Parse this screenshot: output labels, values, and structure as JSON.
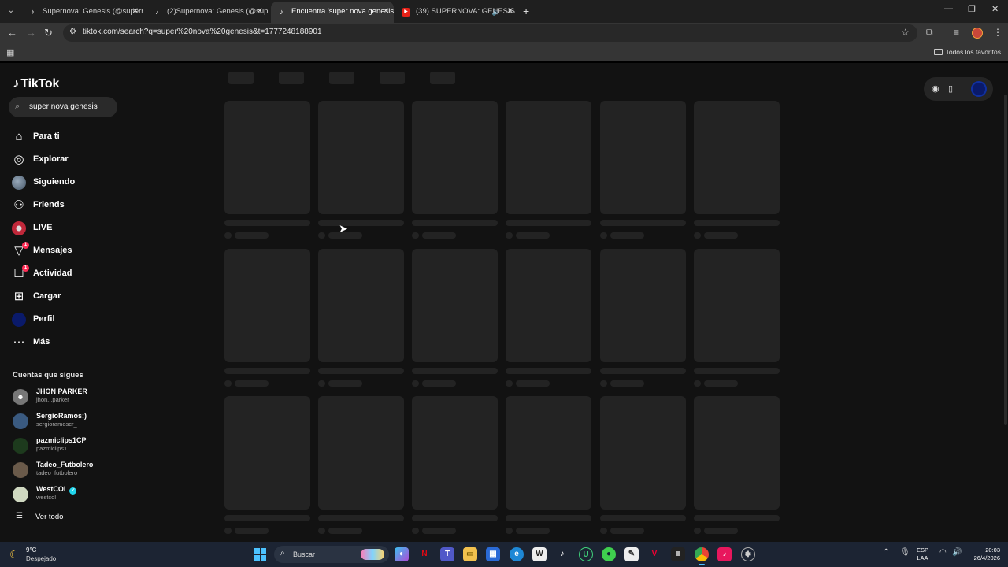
{
  "browser": {
    "tabs": [
      {
        "title": "Supernova: Genesis (@supernov",
        "favicon": "tiktok-icon",
        "active": false
      },
      {
        "title": "(2)Supernova: Genesis (@super",
        "favicon": "tiktok-icon",
        "active": false
      },
      {
        "title": "Encuentra 'super nova genesis'",
        "favicon": "tiktok-icon",
        "active": true
      },
      {
        "title": "(39) SUPERNOVA: GENESIS",
        "favicon": "youtube-icon",
        "active": false,
        "audio": true
      }
    ],
    "url": "tiktok.com/search?q=super%20nova%20genesis&t=1777248188901",
    "bookmarks_all_label": "Todos los favoritos"
  },
  "tiktok": {
    "logo": "TikTok",
    "search_query": "super nova genesis",
    "nav": [
      {
        "label": "Para ti",
        "icon": "home-icon"
      },
      {
        "label": "Explorar",
        "icon": "compass-icon"
      },
      {
        "label": "Siguiendo",
        "icon": "avatar-icon"
      },
      {
        "label": "Friends",
        "icon": "friends-icon"
      },
      {
        "label": "LIVE",
        "icon": "live-icon"
      },
      {
        "label": "Mensajes",
        "icon": "send-icon",
        "badge": "1"
      },
      {
        "label": "Actividad",
        "icon": "inbox-icon",
        "badge": "1"
      },
      {
        "label": "Cargar",
        "icon": "upload-icon"
      },
      {
        "label": "Perfil",
        "icon": "profile-avatar-icon"
      },
      {
        "label": "Más",
        "icon": "more-icon"
      }
    ],
    "following_title": "Cuentas que sigues",
    "following": [
      {
        "name": "JHON PARKER",
        "handle": "jhon...parker",
        "verified": false
      },
      {
        "name": "SergioRamos:)",
        "handle": "sergioramoscr_",
        "verified": false
      },
      {
        "name": "pazmiclips1CP",
        "handle": "pazmiclips1",
        "verified": false
      },
      {
        "name": "Tadeo_Futbolero",
        "handle": "tadeo_futbolero",
        "verified": false
      },
      {
        "name": "WestCOL",
        "handle": "westcol",
        "verified": true
      }
    ],
    "see_all": "Ver todo"
  },
  "taskbar": {
    "weather_temp": "9°C",
    "weather_desc": "Despejado",
    "search_label": "Buscar",
    "lang_line1": "ESP",
    "lang_line2": "LAA",
    "time": "20:03",
    "date": "26/4/2026"
  }
}
